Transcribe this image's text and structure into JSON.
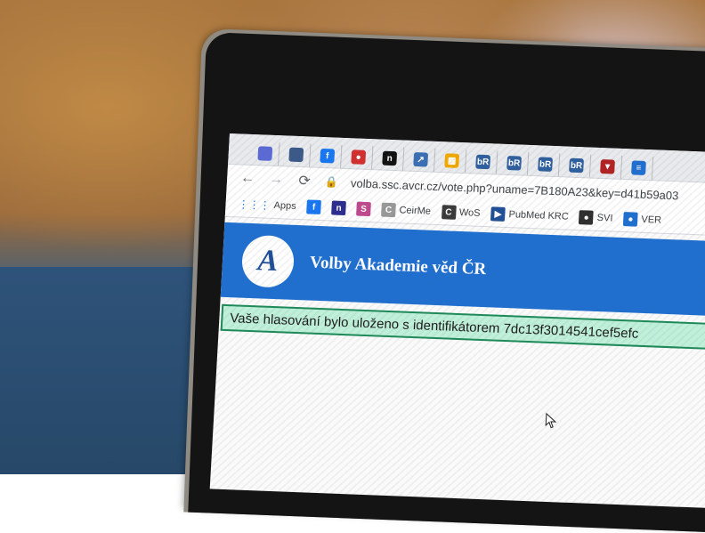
{
  "tabs": [
    {
      "icon": "mail-icon",
      "color": "#5b6bd6",
      "text": ""
    },
    {
      "icon": "document-icon",
      "color": "#3b5a8a",
      "text": ""
    },
    {
      "icon": "facebook-icon",
      "color": "#1877f2",
      "text": "f"
    },
    {
      "icon": "record-icon",
      "color": "#d32f2f",
      "text": "●"
    },
    {
      "icon": "n-logo-icon",
      "color": "#111111",
      "text": "n"
    },
    {
      "icon": "arrow-logo-icon",
      "color": "#3a6fb5",
      "text": "↗"
    },
    {
      "icon": "grid-logo-icon",
      "color": "#f2a900",
      "text": "▦"
    },
    {
      "icon": "br-icon",
      "color": "#2f5f9f",
      "text": "bR"
    },
    {
      "icon": "br-icon",
      "color": "#2f5f9f",
      "text": "bR"
    },
    {
      "icon": "br-icon",
      "color": "#2f5f9f",
      "text": "bR"
    },
    {
      "icon": "br-icon",
      "color": "#2f5f9f",
      "text": "bR"
    },
    {
      "icon": "shield-logo-icon",
      "color": "#b22222",
      "text": "▼"
    },
    {
      "icon": "flag-logo-icon",
      "color": "#1f6fd0",
      "text": "≡"
    }
  ],
  "address_bar": {
    "url": "volba.ssc.avcr.cz/vote.php?uname=7B180A23&key=d41b59a03"
  },
  "bookmarks": {
    "apps_label": "Apps",
    "items": [
      {
        "label": "",
        "icon": "facebook-icon",
        "color": "#1877f2",
        "glyph": "f"
      },
      {
        "label": "",
        "icon": "n-logo-icon",
        "color": "#2d2d8f",
        "glyph": "n"
      },
      {
        "label": "",
        "icon": "s-logo-icon",
        "color": "#c04a8f",
        "glyph": "S"
      },
      {
        "label": "CeirMe",
        "icon": "c-logo-icon",
        "color": "#999999",
        "glyph": "C"
      },
      {
        "label": "WoS",
        "icon": "wos-icon",
        "color": "#3a3a3a",
        "glyph": "C"
      },
      {
        "label": "PubMed KRC",
        "icon": "pubmed-icon",
        "color": "#1f4f96",
        "glyph": "▶"
      },
      {
        "label": "SVI",
        "icon": "globe-icon",
        "color": "#2e2e2e",
        "glyph": "●"
      },
      {
        "label": "VER",
        "icon": "globe-icon",
        "color": "#1f6fd0",
        "glyph": "●"
      }
    ]
  },
  "site": {
    "logo_text": "A",
    "title": "Volby Akademie věd ČR",
    "header_color": "#1f6fd0"
  },
  "notice": {
    "text": "Vaše hlasování bylo uloženo s identifikátorem 7dc13f3014541cef5efc"
  }
}
